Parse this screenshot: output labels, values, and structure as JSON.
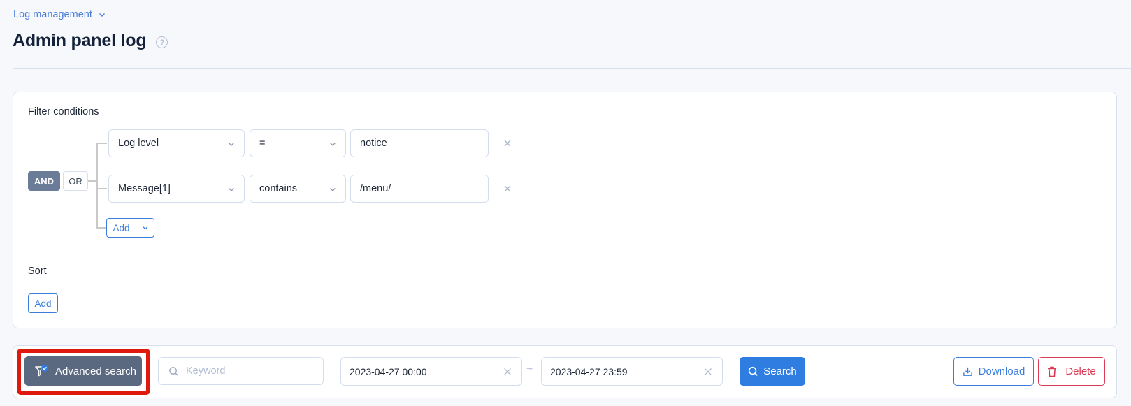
{
  "breadcrumb": {
    "label": "Log management"
  },
  "page": {
    "title": "Admin panel log"
  },
  "filter": {
    "heading": "Filter conditions",
    "logic": {
      "and_label": "AND",
      "or_label": "OR",
      "selected": "AND"
    },
    "conditions": [
      {
        "field": "Log level",
        "operator": "=",
        "value": "notice"
      },
      {
        "field": "Message[1]",
        "operator": "contains",
        "value": "/menu/"
      }
    ],
    "add_label": "Add"
  },
  "sort": {
    "heading": "Sort",
    "add_label": "Add"
  },
  "toolbar": {
    "advanced_search_label": "Advanced search",
    "advanced_search_active": true,
    "keyword_placeholder": "Keyword",
    "keyword_value": "",
    "date_from": "2023-04-27 00:00",
    "date_separator": "~",
    "date_to": "2023-04-27 23:59",
    "search_label": "Search",
    "download_label": "Download",
    "delete_label": "Delete"
  },
  "colors": {
    "primary": "#2f7de1",
    "danger": "#dc3a55",
    "highlight": "#e0190f",
    "advanced_button": "#5a6880"
  }
}
